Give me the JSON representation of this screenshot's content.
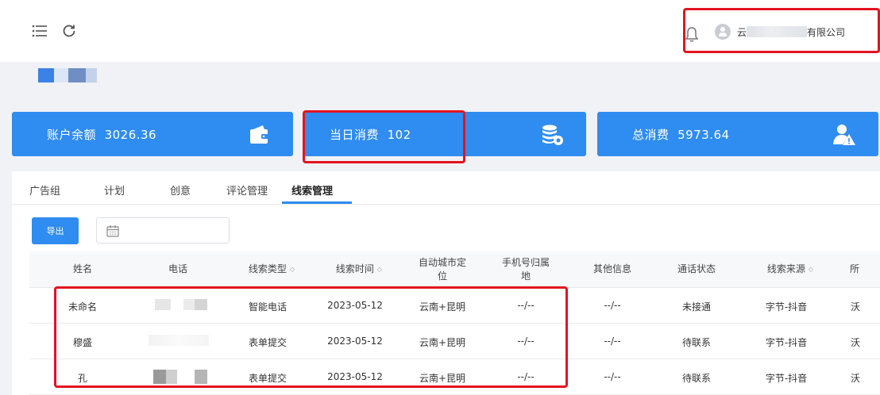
{
  "header": {
    "company_prefix": "云",
    "company_suffix": "有限公司"
  },
  "stats": [
    {
      "label": "账户余额",
      "value": "3026.36",
      "icon": "wallet-icon"
    },
    {
      "label": "当日消费",
      "value": "102",
      "icon": "coins-icon"
    },
    {
      "label": "总消费",
      "value": "5973.64",
      "icon": "user-alert-icon"
    }
  ],
  "tabs": [
    "广告组",
    "计划",
    "创意",
    "评论管理",
    "线索管理"
  ],
  "active_tab": "线索管理",
  "toolbar": {
    "export_label": "导出",
    "date_placeholder": ""
  },
  "table": {
    "columns": [
      {
        "line1": "姓名",
        "line2": "",
        "sortable": false
      },
      {
        "line1": "电话",
        "line2": "",
        "sortable": false
      },
      {
        "line1": "线索类型",
        "line2": "",
        "sortable": true
      },
      {
        "line1": "线索时间",
        "line2": "",
        "sortable": true
      },
      {
        "line1": "自动城市定",
        "line2": "位",
        "sortable": false
      },
      {
        "line1": "手机号归属",
        "line2": "地",
        "sortable": false
      },
      {
        "line1": "其他信息",
        "line2": "",
        "sortable": false
      },
      {
        "line1": "通话状态",
        "line2": "",
        "sortable": false
      },
      {
        "line1": "线索来源",
        "line2": "",
        "sortable": true
      },
      {
        "line1": "所",
        "line2": "",
        "sortable": false
      }
    ],
    "rows": [
      {
        "name": "未命名",
        "type": "智能电话",
        "time": "2023-05-12",
        "city": "云南+昆明",
        "phone_loc": "--/--",
        "other": "--/--",
        "call_status": "未接通",
        "source": "字节-抖音",
        "last": "沃"
      },
      {
        "name": "穆盛",
        "type": "表单提交",
        "time": "2023-05-12",
        "city": "云南+昆明",
        "phone_loc": "--/--",
        "other": "--/--",
        "call_status": "待联系",
        "source": "字节-抖音",
        "last": "沃"
      },
      {
        "name": "孔",
        "type": "表单提交",
        "time": "2023-05-12",
        "city": "云南+昆明",
        "phone_loc": "--/--",
        "other": "--/--",
        "call_status": "待联系",
        "source": "字节-抖音",
        "last": "沃"
      }
    ]
  },
  "colors": {
    "primary": "#2f8cf0",
    "highlight": "#e3141e"
  }
}
